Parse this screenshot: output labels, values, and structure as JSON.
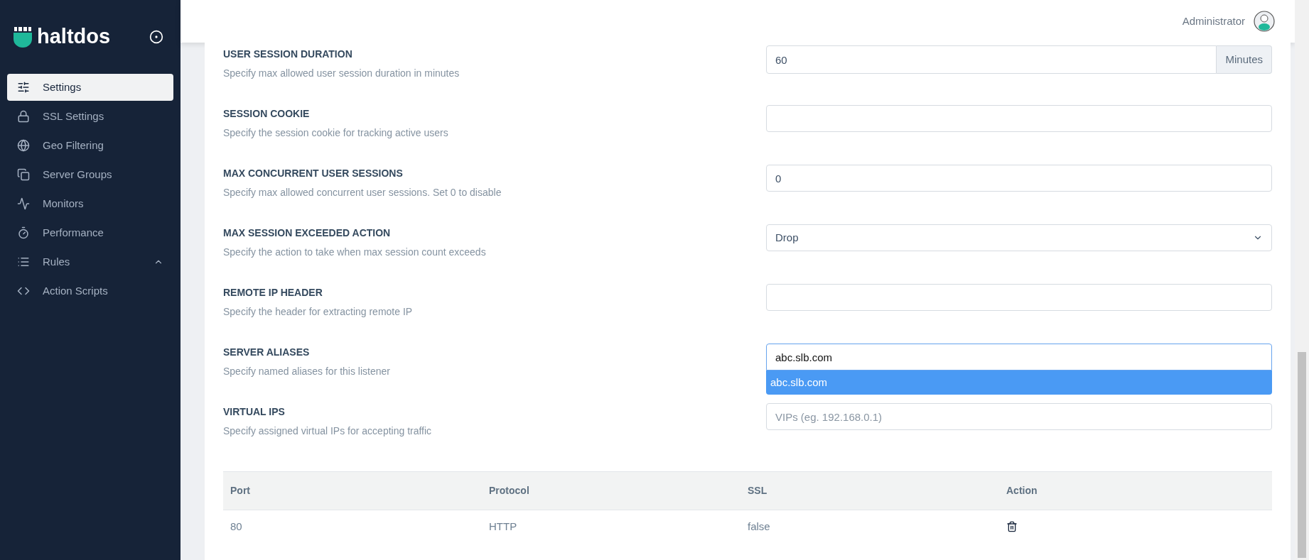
{
  "brand": {
    "name": "haltdos"
  },
  "sidebar": {
    "items": [
      {
        "label": "Settings",
        "selected": true
      },
      {
        "label": "SSL Settings",
        "selected": false
      },
      {
        "label": "Geo Filtering",
        "selected": false
      },
      {
        "label": "Server Groups",
        "selected": false
      },
      {
        "label": "Monitors",
        "selected": false
      },
      {
        "label": "Performance",
        "selected": false
      },
      {
        "label": "Rules",
        "selected": false,
        "expanded": true
      },
      {
        "label": "Action Scripts",
        "selected": false
      }
    ]
  },
  "header": {
    "user": "Administrator"
  },
  "settings": [
    {
      "title": "USER SESSION DURATION",
      "description": "Specify max allowed user session duration in minutes",
      "kind": "addon",
      "value": "60",
      "addon": "Minutes"
    },
    {
      "title": "SESSION COOKIE",
      "description": "Specify the session cookie for tracking active users",
      "kind": "input"
    },
    {
      "title": "MAX CONCURRENT USER SESSIONS",
      "description": "Specify max allowed concurrent user sessions. Set 0 to disable",
      "kind": "input",
      "value": "0"
    },
    {
      "title": "MAX SESSION EXCEEDED ACTION",
      "description": "Specify the action to take when max session count exceeds",
      "kind": "select",
      "value": "Drop"
    },
    {
      "title": "REMOTE IP HEADER",
      "description": "Specify the header for extracting remote IP",
      "kind": "input"
    },
    {
      "title": "SERVER ALIASES",
      "description": "Specify named aliases for this listener",
      "kind": "autocomplete",
      "value": "abc.slb.com",
      "suggestions": [
        {
          "label": "abc.slb.com",
          "selected": true
        }
      ]
    },
    {
      "title": "VIRTUAL IPS",
      "description": "Specify assigned virtual IPs for accepting traffic",
      "kind": "input",
      "placeholder": "VIPs (eg. 192.168.0.1)"
    }
  ],
  "table": {
    "columns": [
      "Port",
      "Protocol",
      "SSL",
      "Action"
    ],
    "rows": [
      {
        "port": "80",
        "protocol": "HTTP",
        "ssl": "false"
      }
    ]
  }
}
